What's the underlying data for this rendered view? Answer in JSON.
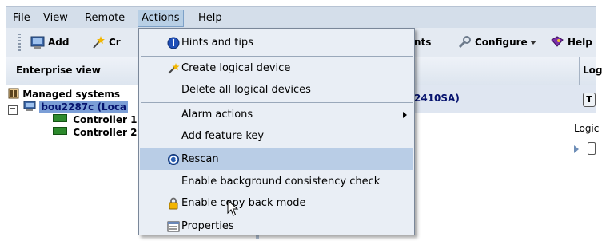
{
  "menubar": {
    "file": "File",
    "view": "View",
    "remote": "Remote",
    "actions": "Actions",
    "help": "Help"
  },
  "toolbar": {
    "add": "Add",
    "create_partial": "Cr",
    "events_partial": "nts",
    "configure": "Configure",
    "help": "Help"
  },
  "left_pane": {
    "header": "Enterprise view",
    "tree": {
      "root": "Managed systems",
      "system": "bou2287c (Loca",
      "controller1": "Controller 1",
      "controller2": "Controller 2"
    }
  },
  "right_pane": {
    "selected_partial": "2410SA)",
    "header_partial": "Logi",
    "logic_partial": "Logic"
  },
  "actions_menu": {
    "items": [
      {
        "label": "Hints and tips"
      },
      {
        "label": "Create logical device"
      },
      {
        "label": "Delete all logical devices"
      },
      {
        "label": "Alarm actions"
      },
      {
        "label": "Add feature key"
      },
      {
        "label": "Rescan"
      },
      {
        "label": "Enable background consistency check"
      },
      {
        "label": "Enable copy back mode"
      },
      {
        "label": "Properties"
      }
    ]
  },
  "colors": {
    "menubar_bg": "#d4deea",
    "highlight": "#b9cde6",
    "selection": "#7b9ed6"
  }
}
